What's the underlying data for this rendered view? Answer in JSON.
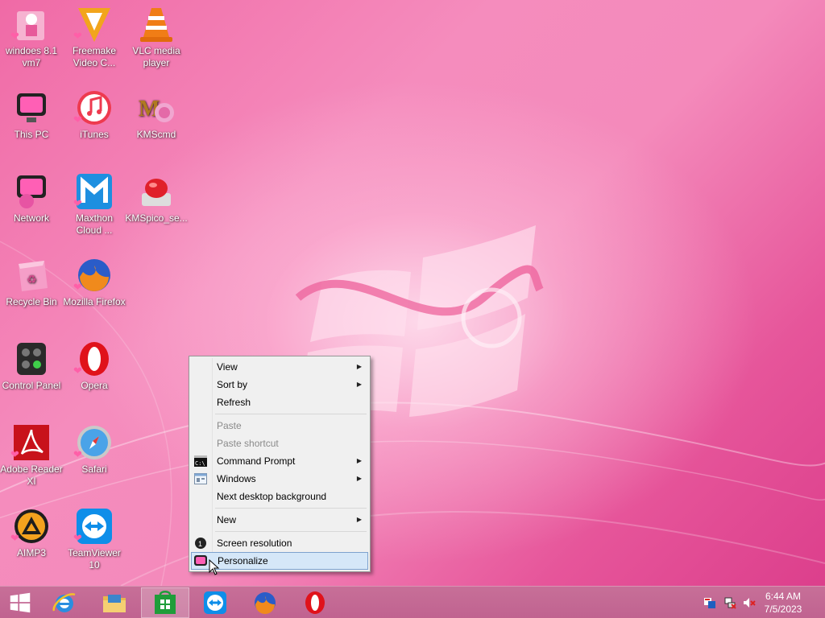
{
  "desktop_icons": [
    {
      "label": "windoes 8.1 vm7",
      "icon": "doll-folder-icon"
    },
    {
      "label": "Freemake Video C...",
      "icon": "freemake-icon"
    },
    {
      "label": "VLC media player",
      "icon": "vlc-icon"
    },
    {
      "label": "This PC",
      "icon": "computer-icon"
    },
    {
      "label": "iTunes",
      "icon": "itunes-icon"
    },
    {
      "label": "KMScmd",
      "icon": "kmscmd-icon"
    },
    {
      "label": "Network",
      "icon": "network-icon"
    },
    {
      "label": "Maxthon Cloud ...",
      "icon": "maxthon-icon"
    },
    {
      "label": "KMSpico_se...",
      "icon": "kmspico-icon"
    },
    {
      "label": "Recycle Bin",
      "icon": "recycle-bin-icon"
    },
    {
      "label": "Mozilla Firefox",
      "icon": "firefox-icon"
    },
    {
      "label": "Control Panel",
      "icon": "control-panel-icon"
    },
    {
      "label": "Opera",
      "icon": "opera-icon"
    },
    {
      "label": "Adobe Reader XI",
      "icon": "adobe-reader-icon"
    },
    {
      "label": "Safari",
      "icon": "safari-icon"
    },
    {
      "label": "AIMP3",
      "icon": "aimp-icon"
    },
    {
      "label": "TeamViewer 10",
      "icon": "teamviewer-icon"
    }
  ],
  "context_menu": {
    "view": "View",
    "sort_by": "Sort by",
    "refresh": "Refresh",
    "paste": "Paste",
    "paste_shortcut": "Paste shortcut",
    "command_prompt": "Command Prompt",
    "windows": "Windows",
    "next_background": "Next desktop background",
    "new": "New",
    "screen_resolution": "Screen resolution",
    "personalize": "Personalize"
  },
  "taskbar": {
    "items": [
      "start-button",
      "internet-explorer-icon",
      "file-explorer-icon",
      "store-icon",
      "teamviewer-icon",
      "firefox-icon",
      "opera-icon"
    ],
    "active_item": "store-icon",
    "clock_time": "6:44 AM",
    "clock_date": "7/5/2023"
  },
  "colors": {
    "desktop_pink": "#f06aa6",
    "taskbar": "#c76f98",
    "menu_bg": "#f0f0f0",
    "menu_highlight": "#d5e7f8"
  }
}
